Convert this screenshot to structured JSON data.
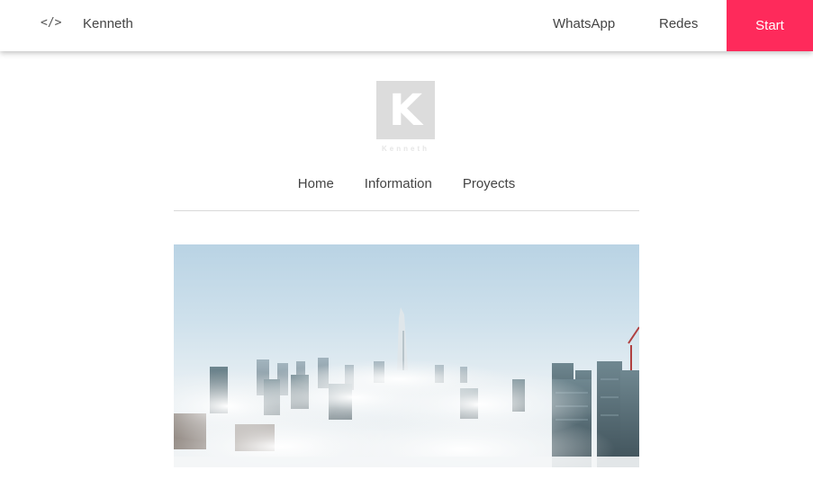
{
  "header": {
    "code_icon": "</>",
    "brand": "Kenneth",
    "links": [
      {
        "label": "WhatsApp"
      },
      {
        "label": "Redes"
      }
    ],
    "start_label": "Start",
    "accent_color": "#fe2a5b"
  },
  "logo": {
    "letter": "K",
    "caption": "Kenneth"
  },
  "nav": {
    "items": [
      {
        "label": "Home"
      },
      {
        "label": "Information"
      },
      {
        "label": "Proyects"
      }
    ]
  },
  "hero": {
    "icon": "city-skyline-above-clouds-image"
  }
}
